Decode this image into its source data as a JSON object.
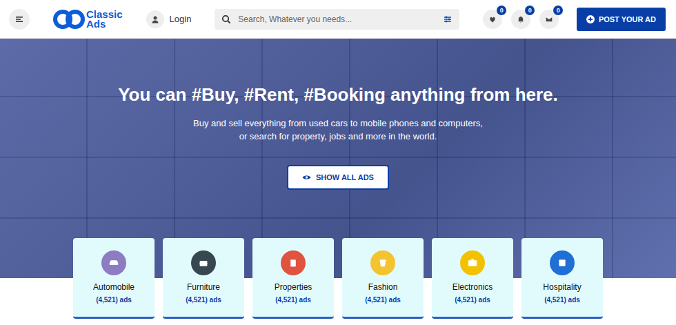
{
  "header": {
    "logo": {
      "line1": "Classic",
      "line2": "Ads"
    },
    "login": "Login",
    "search": {
      "placeholder": "Search, Whatever you needs..."
    },
    "actions": [
      {
        "name": "favorites",
        "badge": "0"
      },
      {
        "name": "notifications",
        "badge": "0"
      },
      {
        "name": "messages",
        "badge": "0"
      }
    ],
    "post_button": "POST YOUR AD"
  },
  "hero": {
    "title": "You can #Buy, #Rent, #Booking anything from here.",
    "subtitle": [
      "Buy and sell everything from used cars to mobile phones and computers,",
      "or search for property, jobs and more in the world."
    ],
    "button": "SHOW ALL ADS"
  },
  "categories": [
    {
      "name": "Automobile",
      "count": "(4,521) ads",
      "color": "#8e7cc3"
    },
    {
      "name": "Furniture",
      "count": "(4,521) ads",
      "color": "#37474f"
    },
    {
      "name": "Properties",
      "count": "(4,521) ads",
      "color": "#e0533f"
    },
    {
      "name": "Fashion",
      "count": "(4,521) ads",
      "color": "#f4c430"
    },
    {
      "name": "Electronics",
      "count": "(4,521) ads",
      "color": "#f2c200"
    },
    {
      "name": "Hospitality",
      "count": "(4,521) ads",
      "color": "#1f6fd6"
    }
  ]
}
